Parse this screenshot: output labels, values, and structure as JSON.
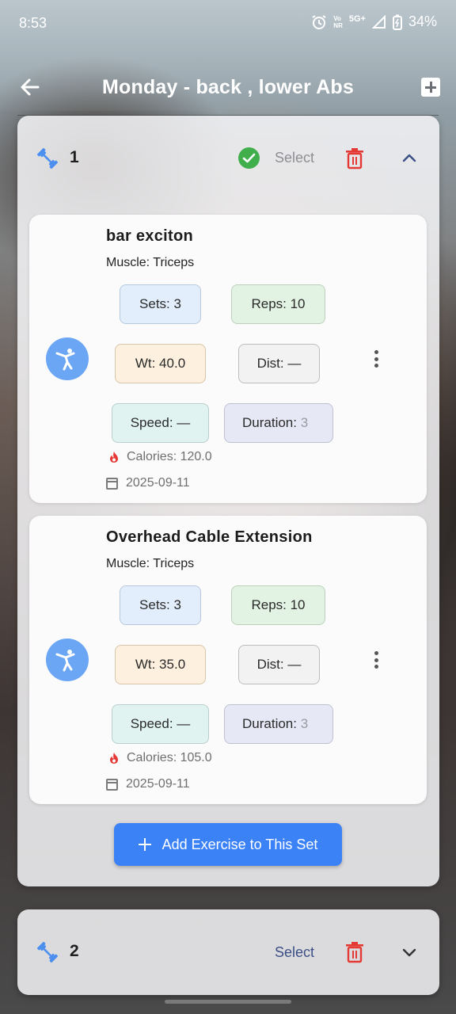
{
  "status_bar": {
    "time": "8:53",
    "network_top": "Vo",
    "network_bottom": "NR",
    "network_type": "5G+",
    "battery": "34%"
  },
  "app_bar": {
    "title": "Monday - back , lower Abs"
  },
  "sets": [
    {
      "number": "1",
      "select_label": "Select",
      "selected": true,
      "expanded": true,
      "exercises": [
        {
          "name": "bar exciton",
          "muscle": "Muscle: Triceps",
          "sets": "Sets: 3",
          "reps": "Reps: 10",
          "weight": "Wt: 40.0",
          "distance": "Dist: —",
          "speed": "Speed: —",
          "duration_visible": "Duration: ",
          "duration_faded": "3",
          "calories": "Calories: 120.0",
          "date": "2025-09-11"
        },
        {
          "name": "Overhead Cable Extension",
          "muscle": "Muscle: Triceps",
          "sets": "Sets: 3",
          "reps": "Reps: 10",
          "weight": "Wt: 35.0",
          "distance": "Dist: —",
          "speed": "Speed: —",
          "duration_visible": "Duration: ",
          "duration_faded": "3",
          "calories": "Calories: 105.0",
          "date": "2025-09-11"
        }
      ],
      "add_exercise_label": "Add Exercise to This Set"
    },
    {
      "number": "2",
      "select_label": "Select",
      "selected": false,
      "expanded": false
    }
  ],
  "colors": {
    "accent_blue": "#3b82f6",
    "check_green": "#3fae4b",
    "delete_red": "#e53935",
    "icon_blue": "#4a8ef0"
  },
  "icons": {
    "back": "arrow-left-icon",
    "add": "add-box-icon",
    "set": "dumbbell-icon",
    "selected": "check-circle-icon",
    "delete": "trash-icon",
    "collapse": "chevron-up-icon",
    "expand": "chevron-down-icon",
    "exercise": "martial-arts-icon",
    "more": "more-vert-icon",
    "calories": "fire-icon",
    "date": "calendar-icon"
  }
}
